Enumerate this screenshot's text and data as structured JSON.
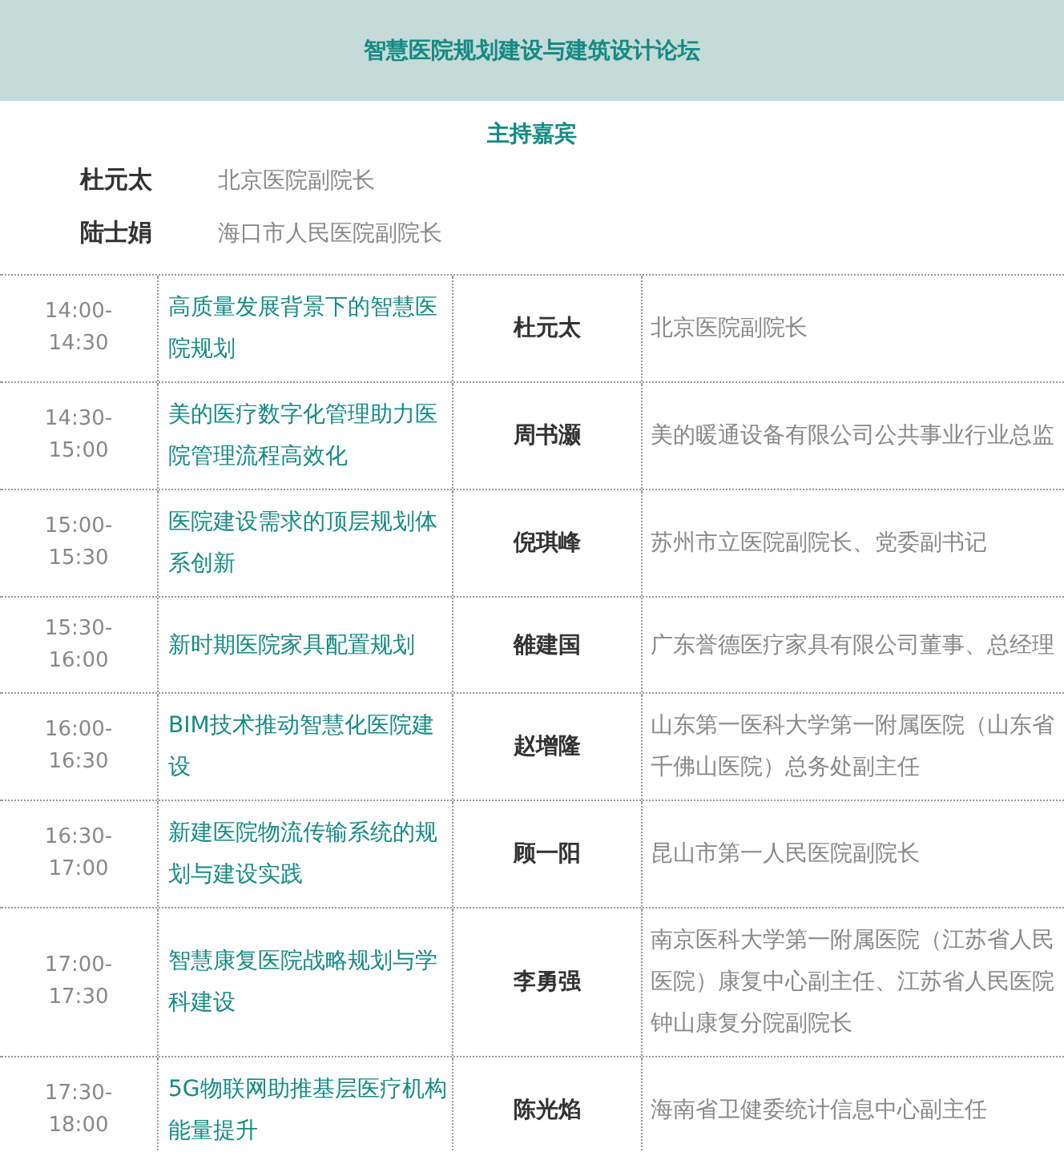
{
  "forum": {
    "title": "智慧医院规划建设与建筑设计论坛"
  },
  "hosts": {
    "heading": "主持嘉宾",
    "items": [
      {
        "name": "杜元太",
        "position": "北京医院副院长"
      },
      {
        "name": "陆士娟",
        "position": "海口市人民医院副院长"
      }
    ]
  },
  "schedule": [
    {
      "start": "14:00-",
      "end": "14:30",
      "topic": "高质量发展背景下的智慧医院规划",
      "speaker": "杜元太",
      "position": "北京医院副院长"
    },
    {
      "start": "14:30-",
      "end": "15:00",
      "topic": "美的医疗数字化管理助力医院管理流程高效化",
      "speaker": "周书灏",
      "position": "美的暖通设备有限公司公共事业行业总监"
    },
    {
      "start": "15:00-",
      "end": "15:30",
      "topic": "医院建设需求的顶层规划体系创新",
      "speaker": "倪琪峰",
      "position": "苏州市立医院副院长、党委副书记"
    },
    {
      "start": "15:30-",
      "end": "16:00",
      "topic": "新时期医院家具配置规划",
      "speaker": "雒建国",
      "position": "广东誉德医疗家具有限公司董事、总经理"
    },
    {
      "start": "16:00-",
      "end": "16:30",
      "topic": "BIM技术推动智慧化医院建设",
      "speaker": "赵增隆",
      "position": "山东第一医科大学第一附属医院（山东省千佛山医院）总务处副主任"
    },
    {
      "start": "16:30-",
      "end": "17:00",
      "topic": "新建医院物流传输系统的规划与建设实践",
      "speaker": "顾一阳",
      "position": "昆山市第一人民医院副院长"
    },
    {
      "start": "17:00-",
      "end": "17:30",
      "topic": "智慧康复医院战略规划与学科建设",
      "speaker": "李勇强",
      "position": "南京医科大学第一附属医院（江苏省人民医院）康复中心副主任、江苏省人民医院钟山康复分院副院长"
    },
    {
      "start": "17:30-",
      "end": "18:00",
      "topic": "5G物联网助推基层医疗机构能量提升",
      "speaker": "陈光焰",
      "position": "海南省卫健委统计信息中心副主任"
    }
  ]
}
